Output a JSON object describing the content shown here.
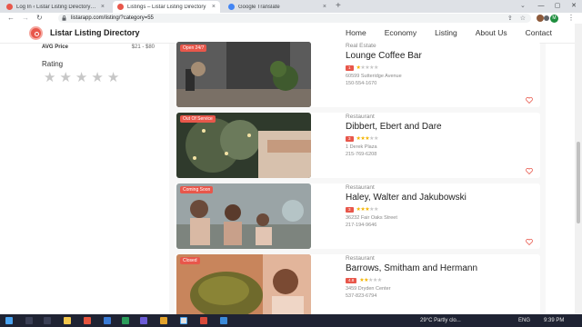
{
  "browser": {
    "tabs": [
      {
        "title": "Log In ‹ Listar Listing Directory — W",
        "close": "×",
        "active": false,
        "favicon_color": "#e8574b"
      },
      {
        "title": "Listings – Listar Listing Directory",
        "close": "×",
        "active": true,
        "favicon_color": "#e8574b"
      },
      {
        "title": "Google Translate",
        "close": "×",
        "active": false,
        "favicon_color": "#4285f4"
      }
    ],
    "new_tab": "+",
    "tab_search": "⌄",
    "window_controls": {
      "minimize": "—",
      "maximize": "▢",
      "close": "✕"
    },
    "url": "listarapp.com/listing/?category=55",
    "back": "←",
    "forward": "→",
    "reload": "↻",
    "share": "⇪",
    "bookmark": "☆",
    "profile_initial": "M",
    "menu": "⋮"
  },
  "site": {
    "brand": "Listar Listing Directory",
    "nav": [
      "Home",
      "Economy",
      "Listing",
      "About Us",
      "Contact"
    ]
  },
  "sidebar": {
    "avg_price_label": "AVG Price",
    "avg_price_value": "$21 - $80",
    "rating_label": "Rating",
    "stars": 5
  },
  "listings": [
    {
      "category": "Real Estate",
      "title": "Lounge Coffee Bar",
      "badge": "Open 24/7",
      "score": "1",
      "rating": 1,
      "address": "60599 Sutteridge Avenue",
      "phone": "150-554-1670",
      "badge_color": "#e8574b"
    },
    {
      "category": "Restaurant",
      "title": "Dibbert, Ebert and Dare",
      "badge": "Out Of Service",
      "score": "3",
      "rating": 3,
      "address": "1 Derek Plaza",
      "phone": "215-769-6208",
      "badge_color": "#e8574b"
    },
    {
      "category": "Restaurant",
      "title": "Haley, Walter and Jakubowski",
      "badge": "Coming Soon",
      "score": "3",
      "rating": 3,
      "address": "36232 Fair Oaks Street",
      "phone": "217-194-9646",
      "badge_color": "#e8574b"
    },
    {
      "category": "Restaurant",
      "title": "Barrows, Smitham and Hermann",
      "badge": "Closed",
      "score": "4.8",
      "rating": 2,
      "address": "3459 Dryden Center",
      "phone": "537-823-6794",
      "badge_color": "#e8574b"
    }
  ],
  "taskbar": {
    "weather": "29°C  Partly clo...",
    "lang": "ENG",
    "time": "9:39 PM"
  }
}
